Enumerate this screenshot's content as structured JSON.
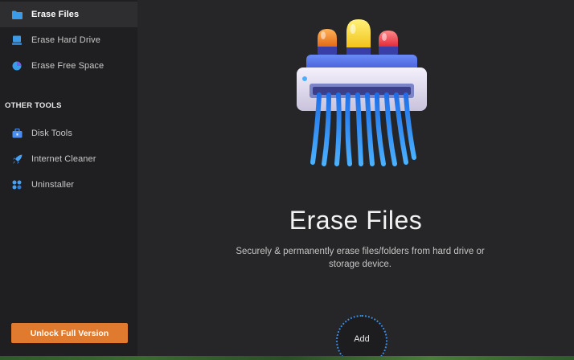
{
  "sidebar": {
    "items": [
      {
        "label": "Erase Files",
        "icon": "folder-icon"
      },
      {
        "label": "Erase Hard Drive",
        "icon": "hard-drive-icon"
      },
      {
        "label": "Erase Free Space",
        "icon": "pie-chart-icon"
      }
    ],
    "section_title": "OTHER TOOLS",
    "tools": [
      {
        "label": "Disk Tools",
        "icon": "toolbox-icon"
      },
      {
        "label": "Internet Cleaner",
        "icon": "rocket-icon"
      },
      {
        "label": "Uninstaller",
        "icon": "apps-grid-icon"
      }
    ],
    "unlock_label": "Unlock Full Version"
  },
  "main": {
    "title": "Erase Files",
    "description": "Securely & permanently erase files/folders from hard drive or storage device.",
    "add_label": "Add",
    "hero_icon": "file-shredder-icon"
  },
  "colors": {
    "accent_orange": "#e07a2e",
    "accent_blue": "#3d8be0",
    "sidebar_bg": "#1f1f21",
    "main_bg": "#262628"
  }
}
